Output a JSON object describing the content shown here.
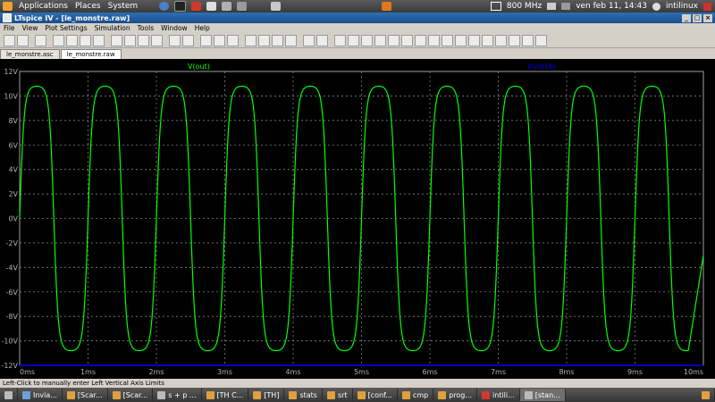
{
  "top_panel": {
    "menus": [
      "Applications",
      "Places",
      "System"
    ],
    "cpu_freq": "800 MHz",
    "clock": "ven feb 11, 14:43",
    "user": "intilinux"
  },
  "window": {
    "title": "LTspice IV - [le_monstre.raw]"
  },
  "menubar": [
    "File",
    "View",
    "Plot Settings",
    "Simulation",
    "Tools",
    "Window",
    "Help"
  ],
  "tabs": [
    {
      "label": "le_monstre.asc"
    },
    {
      "label": "le_monstre.raw"
    }
  ],
  "plot": {
    "traces": [
      {
        "name": "V(out)",
        "color": "#00ff00"
      },
      {
        "name": "V(n016)",
        "color": "#0000ff"
      }
    ]
  },
  "status": {
    "text": "Left-Click to manually enter Left Vertical Axis Limits"
  },
  "taskbar": [
    "Invia...",
    "[Scar...",
    "[Scar...",
    "s + p ...",
    "[TH C...",
    "[TH]",
    "stats",
    "srt",
    "[conf...",
    "cmp",
    "prog...",
    "intili...",
    "[stan..."
  ],
  "chart_data": {
    "type": "line",
    "xlabel": "",
    "ylabel": "",
    "xlim": [
      0,
      10
    ],
    "ylim": [
      -12,
      12
    ],
    "x_tick_labels": [
      "0ms",
      "1ms",
      "2ms",
      "3ms",
      "4ms",
      "5ms",
      "6ms",
      "7ms",
      "8ms",
      "9ms",
      "10ms"
    ],
    "y_tick_labels": [
      "12V",
      "10V",
      "8V",
      "6V",
      "4V",
      "2V",
      "0V",
      "-2V",
      "-4V",
      "-6V",
      "-8V",
      "-10V",
      "-12V"
    ],
    "grid": true,
    "series": [
      {
        "name": "V(out)",
        "color": "#00ff00",
        "frequency_khz": 1,
        "peak_v": 10.8,
        "trough_v": -10.8,
        "x_ms": [
          0,
          0.25,
          0.5,
          0.75,
          1,
          1.25,
          1.5,
          1.75,
          2,
          2.25,
          2.5,
          2.75,
          3,
          3.25,
          3.5,
          3.75,
          4,
          4.25,
          4.5,
          4.75,
          5,
          5.25,
          5.5,
          5.75,
          6,
          6.25,
          6.5,
          6.75,
          7,
          7.25,
          7.5,
          7.75,
          8,
          8.25,
          8.5,
          8.75,
          9,
          9.25,
          9.5,
          9.75,
          10
        ],
        "y_v": [
          0,
          10.8,
          0,
          -10.8,
          0,
          10.8,
          0,
          -10.8,
          0,
          10.8,
          0,
          -10.8,
          0,
          10.8,
          0,
          -10.8,
          0,
          10.8,
          0,
          -10.8,
          0,
          10.8,
          0,
          -10.8,
          0,
          10.8,
          0,
          -10.8,
          0,
          10.8,
          0,
          -10.8,
          0,
          10.8,
          0,
          -10.8,
          0,
          10.8,
          0,
          -10.8,
          -3
        ]
      },
      {
        "name": "V(n016)",
        "color": "#0000ff",
        "x_ms": [
          0,
          10
        ],
        "y_v": [
          -12,
          -12
        ]
      }
    ]
  }
}
